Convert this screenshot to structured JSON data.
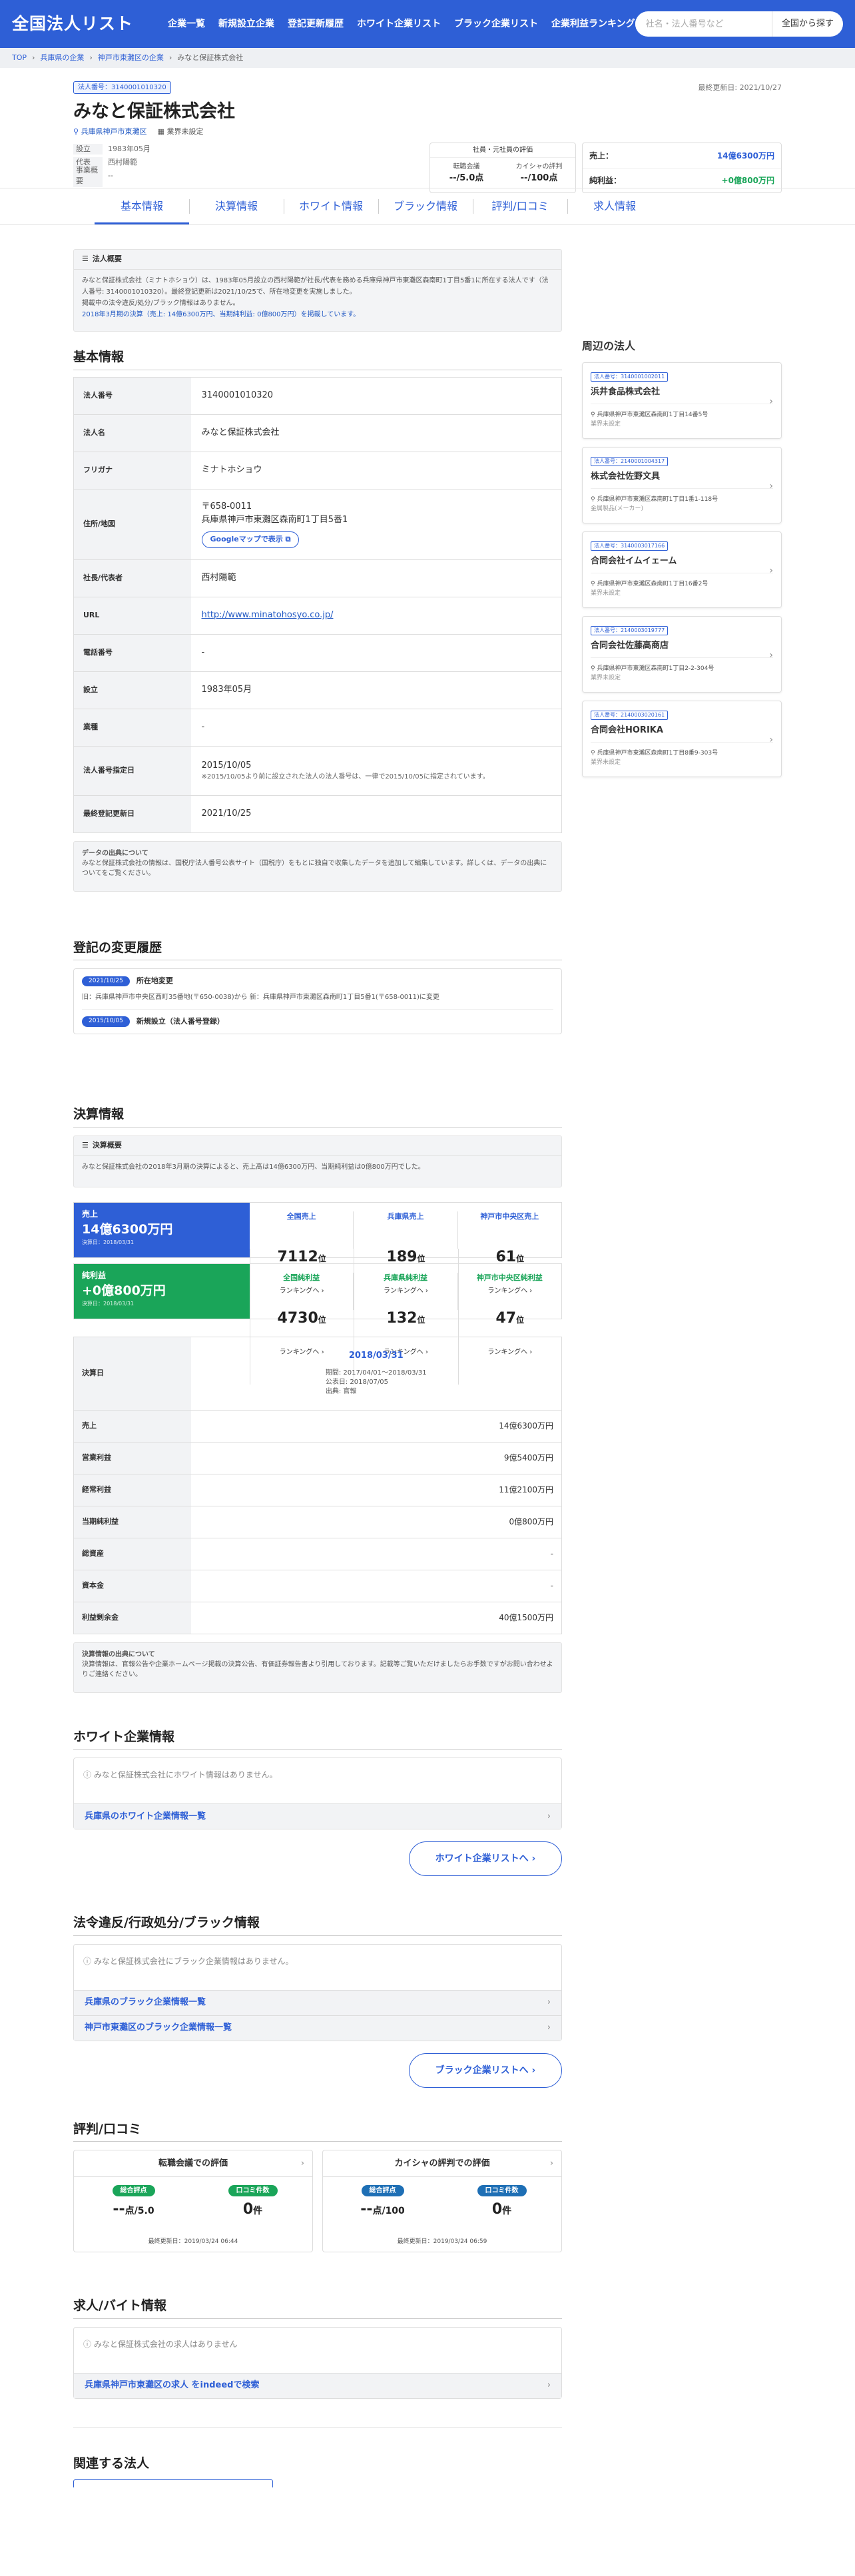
{
  "header": {
    "logo": "全国法人リスト",
    "nav": [
      "企業一覧",
      "新規設立企業",
      "登記更新履歴",
      "ホワイト企業リスト",
      "ブラック企業リスト",
      "企業利益ランキング"
    ],
    "search_placeholder": "社名・法人番号など",
    "search_button": "全国から探す"
  },
  "breadcrumb": [
    "TOP",
    "兵庫県の企業",
    "神戸市東灘区の企業",
    "みなと保証株式会社"
  ],
  "company": {
    "number_badge": "法人番号：3140001010320",
    "updated": "最終更新日: 2021/10/27",
    "name": "みなと保証株式会社",
    "location": "兵庫県神戸市東灘区",
    "industry": "業界未設定",
    "meta": [
      {
        "k": "設立",
        "v": "1983年05月"
      },
      {
        "k": "代表",
        "v": "西村陽範"
      },
      {
        "k": "事業概要",
        "v": "--"
      }
    ],
    "eval": {
      "title": "社員・元社員の評価",
      "items": [
        {
          "label": "転職会議",
          "value": "--/5.0点"
        },
        {
          "label": "カイシャの評判",
          "value": "--/100点"
        }
      ]
    },
    "finance": [
      {
        "label": "売上：",
        "value": "14億6300万円",
        "color": "#2e5fd6"
      },
      {
        "label": "純利益：",
        "value": "+0億800万円",
        "color": "#1aa559"
      }
    ]
  },
  "tabs": [
    "基本情報",
    "決算情報",
    "ホワイト情報",
    "ブラック情報",
    "評判/口コミ",
    "求人情報"
  ],
  "overview": {
    "title": "法人概要",
    "text1": "みなと保証株式会社（ミナトホショウ）は、1983年05月設立の西村陽範が社長/代表を務める兵庫県神戸市東灘区森南町1丁目5番1に所在する法人です（法人番号: 3140001010320）。最終登記更新は2021/10/25で、所在地変更を実施しました。",
    "text2": "掲載中の法令違反/処分/ブラック情報はありません。",
    "text3": "2018年3月期の決算（売上: 14億6300万円、当期純利益: 0億800万円）を掲載しています。"
  },
  "basic": {
    "title": "基本情報",
    "rows": [
      {
        "k": "法人番号",
        "v": "3140001010320"
      },
      {
        "k": "法人名",
        "v": "みなと保証株式会社"
      },
      {
        "k": "フリガナ",
        "v": "ミナトホショウ"
      },
      {
        "k": "住所/地図",
        "v": "〒658-0011",
        "v2": "兵庫県神戸市東灘区森南町1丁目5番1",
        "btn": "Googleマップで表示"
      },
      {
        "k": "社長/代表者",
        "v": "西村陽範"
      },
      {
        "k": "URL",
        "v": "http://www.minatohosyo.co.jp/"
      },
      {
        "k": "電話番号",
        "v": "-"
      },
      {
        "k": "設立",
        "v": "1983年05月"
      },
      {
        "k": "業種",
        "v": "-"
      },
      {
        "k": "法人番号指定日",
        "v": "2015/10/05",
        "sub": "※2015/10/05より前に設立された法人の法人番号は、一律で2015/10/05に指定されています。"
      },
      {
        "k": "最終登記更新日",
        "v": "2021/10/25"
      }
    ],
    "source_title": "データの出典について",
    "source_text": "みなと保証株式会社の情報は、国税庁法人番号公表サイト（国税庁）をもとに独自で収集したデータを追加して編集しています。詳しくは、データの出典についてをご覧ください。"
  },
  "history": {
    "title": "登記の変更履歴",
    "items": [
      {
        "date": "2021/10/25",
        "label": "所在地変更",
        "detail": "旧：兵庫県神戸市中央区西町35番地(〒650-0038)から 新：兵庫県神戸市東灘区森南町1丁目5番1(〒658-0011)に変更"
      },
      {
        "date": "2015/10/05",
        "label": "新規設立（法人番号登録）",
        "detail": ""
      }
    ]
  },
  "settlement": {
    "title": "決算情報",
    "summary_title": "決算概要",
    "summary_text": "みなと保証株式会社の2018年3月期の決算によると、売上高は14億6300万円、当期純利益は0億800万円でした。",
    "rows": [
      {
        "label": "売上",
        "value": "14億6300万円",
        "date": "決算日：2018/03/31",
        "color": "#2e5fd6",
        "ranks": [
          {
            "l": "全国売上",
            "r": "7112",
            "c": "#2e5fd6"
          },
          {
            "l": "兵庫県売上",
            "r": "189",
            "c": "#2e5fd6"
          },
          {
            "l": "神戸市中央区売上",
            "r": "61",
            "c": "#2e5fd6"
          }
        ]
      },
      {
        "label": "純利益",
        "value": "+0億800万円",
        "date": "決算日：2018/03/31",
        "color": "#1aa559",
        "ranks": [
          {
            "l": "全国純利益",
            "r": "4730",
            "c": "#1aa559"
          },
          {
            "l": "兵庫県純利益",
            "r": "132",
            "c": "#1aa559"
          },
          {
            "l": "神戸市中央区純利益",
            "r": "47",
            "c": "#1aa559"
          }
        ]
      }
    ],
    "rank_unit": "位",
    "rank_link": "ランキングへ",
    "table": {
      "head_label": "決算日",
      "date": "2018/03/31",
      "period": "期間: 2017/04/01～2018/03/31",
      "published": "公表日: 2018/07/05",
      "source": "出典: 官報",
      "rows": [
        {
          "k": "売上",
          "v": "14億6300万円"
        },
        {
          "k": "営業利益",
          "v": "9億5400万円"
        },
        {
          "k": "経常利益",
          "v": "11億2100万円"
        },
        {
          "k": "当期純利益",
          "v": "0億800万円"
        },
        {
          "k": "総資産",
          "v": "-"
        },
        {
          "k": "資本金",
          "v": "-"
        },
        {
          "k": "利益剰余金",
          "v": "40億1500万円"
        }
      ]
    },
    "source_title": "決算情報の出典について",
    "source_text": "決算情報は、官報公告や企業ホームページ掲載の決算公告、有価証券報告書より引用しております。記載等ご覧いただけましたらお手数ですがお問い合わせよりご連絡ください。"
  },
  "white": {
    "title": "ホワイト企業情報",
    "empty": "みなと保証株式会社にホワイト情報はありません。",
    "links": [
      "兵庫県のホワイト企業情報一覧"
    ],
    "button": "ホワイト企業リストへ"
  },
  "black": {
    "title": "法令違反/行政処分/ブラック情報",
    "empty": "みなと保証株式会社にブラック企業情報はありません。",
    "links": [
      "兵庫県のブラック企業情報一覧",
      "神戸市東灘区のブラック企業情報一覧"
    ],
    "button": "ブラック企業リストへ"
  },
  "reviews": {
    "title": "評判/口コミ",
    "boxes": [
      {
        "title": "転職会議での評価",
        "score_label": "総合評点",
        "score": "--",
        "score_unit": "点/5.0",
        "count_label": "口コミ件数",
        "count": "0",
        "count_unit": "件",
        "updated": "最終更新日：2019/03/24 06:44",
        "c1": "#1aa559",
        "c2": "#1aa559"
      },
      {
        "title": "カイシャの評判での評価",
        "score_label": "総合評点",
        "score": "--",
        "score_unit": "点/100",
        "count_label": "口コミ件数",
        "count": "0",
        "count_unit": "件",
        "updated": "最終更新日：2019/03/24 06:59",
        "c1": "#1e6fb5",
        "c2": "#1e6fb5"
      }
    ]
  },
  "jobs": {
    "title": "求人/バイト情報",
    "empty": "みなと保証株式会社の求人はありません",
    "links": [
      "兵庫県神戸市東灘区の求人 をindeedで検索"
    ]
  },
  "related": {
    "title": "関連する法人"
  },
  "nearby": {
    "title": "周辺の法人",
    "items": [
      {
        "no": "法人番号：3140001002011",
        "name": "浜井食品株式会社",
        "addr": "兵庫県神戸市東灘区森南町1丁目14番5号",
        "ind": "業界未設定"
      },
      {
        "no": "法人番号：2140001004317",
        "name": "株式会社佐野文具",
        "addr": "兵庫県神戸市東灘区森南町1丁目1番1-118号",
        "ind": "金属製品(メーカー)"
      },
      {
        "no": "法人番号：3140003017166",
        "name": "合同会社イムイェーム",
        "addr": "兵庫県神戸市東灘区森南町1丁目16番2号",
        "ind": "業界未設定"
      },
      {
        "no": "法人番号：2140003019777",
        "name": "合同会社佐藤高商店",
        "addr": "兵庫県神戸市東灘区森南町1丁目2-2-304号",
        "ind": "業界未設定"
      },
      {
        "no": "法人番号：2140003020161",
        "name": "合同会社HORIKA",
        "addr": "兵庫県神戸市東灘区森南町1丁目8番9-303号",
        "ind": "業界未設定"
      }
    ]
  }
}
